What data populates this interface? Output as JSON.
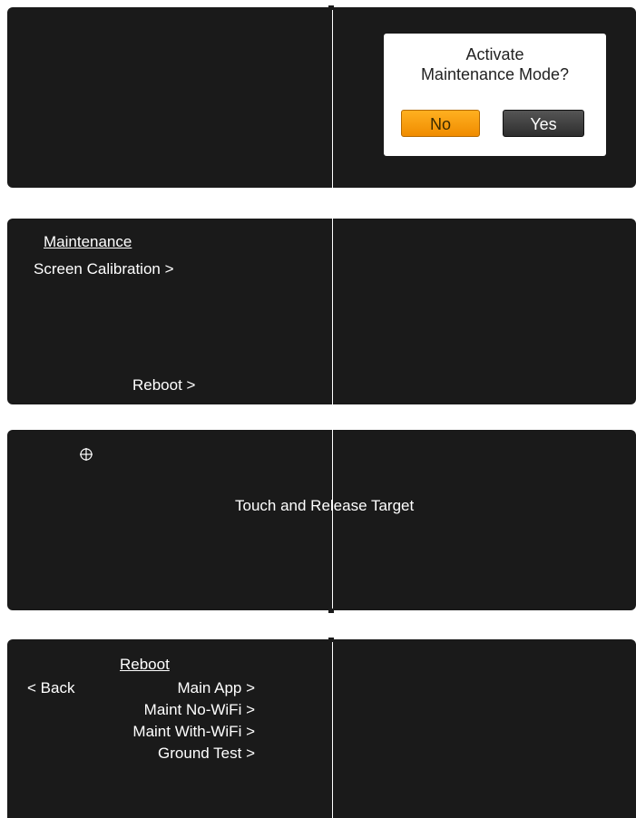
{
  "screen1": {
    "dialog": {
      "question_line1": "Activate",
      "question_line2": "Maintenance Mode?",
      "no_label": "No",
      "yes_label": "Yes"
    }
  },
  "screen2": {
    "title": "Maintenance",
    "calibration_label": "Screen Calibration >",
    "reboot_label": "Reboot >"
  },
  "screen3": {
    "instruction": "Touch and Release Target",
    "target_icon": "crosshair-target-icon"
  },
  "screen4": {
    "title": "Reboot",
    "back_label": "< Back",
    "options": [
      "Main App >",
      "Maint No-WiFi >",
      "Maint With-WiFi >",
      "Ground Test >"
    ]
  },
  "colors": {
    "panel": "#1a1a1a",
    "no_button": "#f5a000",
    "yes_button": "#3c3c3c",
    "dialog_bg": "#ffffff"
  }
}
